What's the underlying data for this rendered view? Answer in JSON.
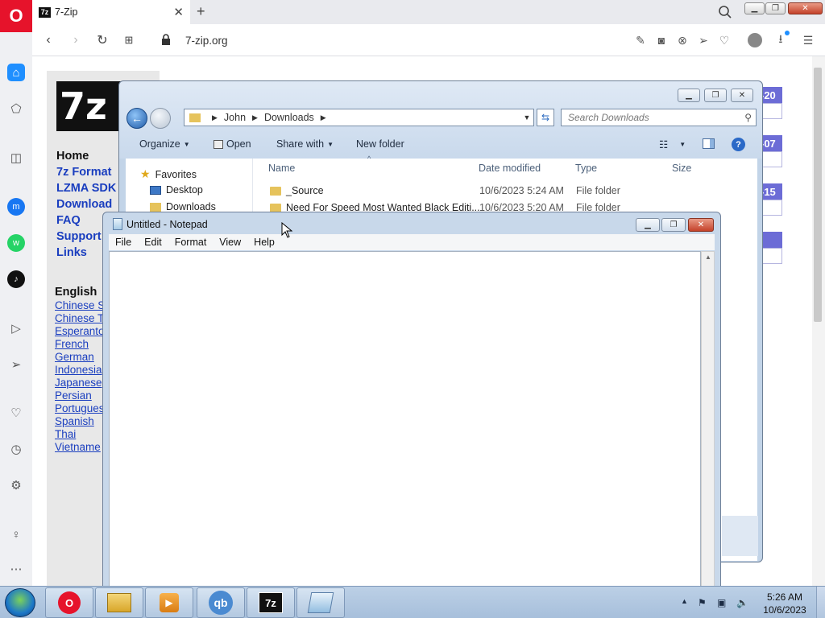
{
  "browser": {
    "tab_title": "7-Zip",
    "tab_favicon": "7z",
    "url": "7-zip.org"
  },
  "page": {
    "logo_text": "7z",
    "nav": [
      "Home",
      "7z Format",
      "LZMA SDK",
      "Download",
      "FAQ",
      "Support",
      "Links"
    ],
    "languages_heading": "English",
    "languages": [
      "Chinese S",
      "Chinese T",
      "Esperanto",
      "French",
      "German",
      "Indonesia",
      "Japanese",
      "Persian",
      "Portugues",
      "Spanish",
      "Thai",
      "Vietname"
    ],
    "news_dates": [
      "-20",
      "-07",
      "-15"
    ]
  },
  "explorer": {
    "breadcrumb": [
      "John",
      "Downloads"
    ],
    "search_placeholder": "Search Downloads",
    "commands": {
      "organize": "Organize",
      "open": "Open",
      "share_with": "Share with",
      "new_folder": "New folder"
    },
    "nav_pane": {
      "favorites": "Favorites",
      "desktop": "Desktop",
      "downloads": "Downloads"
    },
    "columns": {
      "name": "Name",
      "date_modified": "Date modified",
      "type": "Type",
      "size": "Size"
    },
    "files": [
      {
        "name": "_Source",
        "date": "10/6/2023 5:24 AM",
        "type": "File folder"
      },
      {
        "name": "Need For Speed Most Wanted Black Editi...",
        "date": "10/6/2023 5:20 AM",
        "type": "File folder"
      }
    ]
  },
  "notepad": {
    "title": "Untitled - Notepad",
    "menus": [
      "File",
      "Edit",
      "Format",
      "View",
      "Help"
    ],
    "content": ""
  },
  "taskbar": {
    "time": "5:26 AM",
    "date": "10/6/2023"
  }
}
